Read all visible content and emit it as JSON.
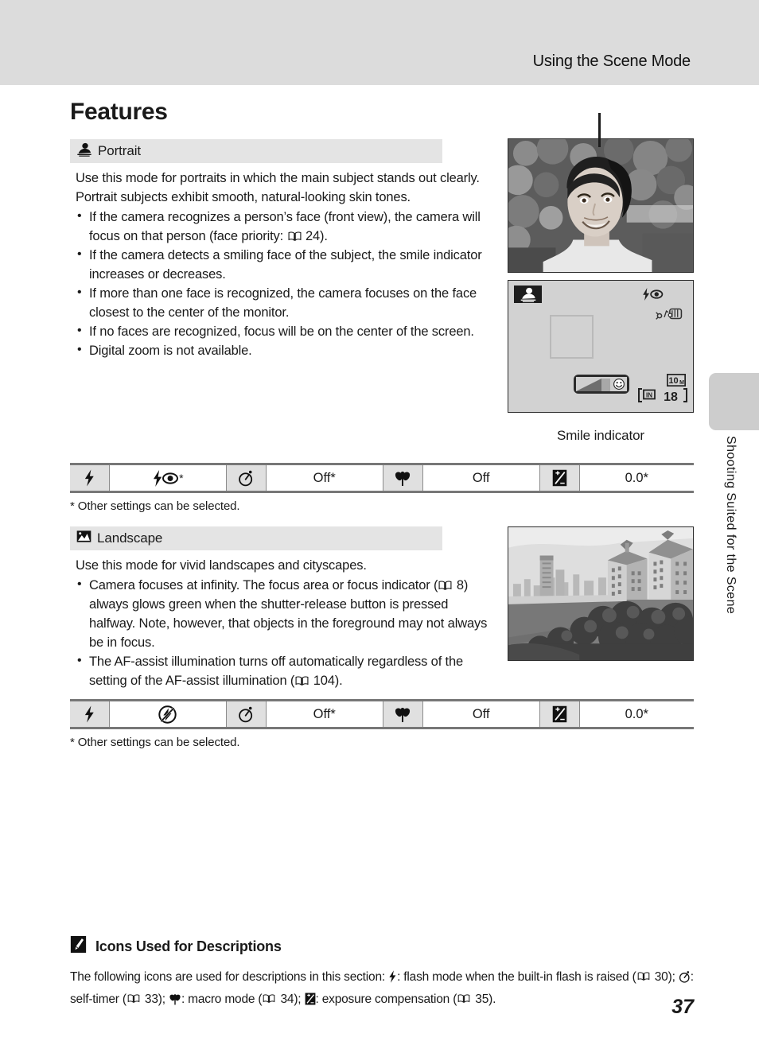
{
  "header": {
    "running_title": "Using the Scene Mode"
  },
  "page_heading": "Features",
  "sections": [
    {
      "id": "portrait",
      "icon": "portrait-mode-icon",
      "title": "Portrait",
      "intro": "Use this mode for portraits in which the main subject stands out clearly. Portrait subjects exhibit smooth, natural-looking skin tones.",
      "bullets": [
        {
          "pre": "If the camera recognizes a person’s face (front view), the camera will focus on that person (face priority: ",
          "ref": "24",
          "post": ")."
        },
        {
          "pre": "If the camera detects a smiling face of the subject, the smile indicator increases or decreases.",
          "ref": "",
          "post": ""
        },
        {
          "pre": "If more than one face is recognized, the camera focuses on the face closest to the center of the monitor.",
          "ref": "",
          "post": ""
        },
        {
          "pre": "If no faces are recognized, focus will be on the center of the screen.",
          "ref": "",
          "post": ""
        },
        {
          "pre": "Digital zoom is not available.",
          "ref": "",
          "post": ""
        }
      ]
    },
    {
      "id": "landscape",
      "icon": "landscape-mode-icon",
      "title": "Landscape",
      "intro": "Use this mode for vivid landscapes and cityscapes.",
      "bullets": [
        {
          "pre": "Camera focuses at infinity. The focus area or focus indicator (",
          "ref": "8",
          "post": ") always glows green when the shutter-release button is pressed halfway. Note, however, that objects in the foreground may not always be in focus."
        },
        {
          "pre": "The AF-assist illumination turns off automatically regardless of the setting of the AF-assist illumination (",
          "ref": "104",
          "post": ")."
        }
      ]
    }
  ],
  "monitor": {
    "mode_icon": "portrait-mode-icon",
    "flash_icon": "flash-red-eye-icon",
    "vr_icon": "vibration-reduction-icon",
    "focus_frame": "focus-area-frame",
    "smile_indicator_icon": "smiley-face-icon",
    "image_size": "10",
    "image_size_unit": "M",
    "memory_label": "IN",
    "shots_remaining": "18",
    "caption": "Smile indicator"
  },
  "photos": [
    {
      "name": "portrait-sample-photo",
      "alt": "Black and white photo of a smiling woman outdoors in front of foliage"
    },
    {
      "name": "landscape-sample-photo",
      "alt": "Black and white photo of apartment buildings beside water with trees"
    }
  ],
  "settings_tables": [
    {
      "id": "portrait-settings",
      "cells": [
        {
          "type": "icon",
          "icon": "flash-mode-icon"
        },
        {
          "type": "value",
          "value": "",
          "icon": "flash-auto-red-eye-icon",
          "suffix": "*"
        },
        {
          "type": "icon",
          "icon": "self-timer-icon"
        },
        {
          "type": "value",
          "value": "Off*"
        },
        {
          "type": "icon",
          "icon": "macro-mode-icon"
        },
        {
          "type": "value",
          "value": "Off"
        },
        {
          "type": "icon",
          "icon": "exposure-compensation-icon"
        },
        {
          "type": "value",
          "value": "0.0*"
        }
      ],
      "footnote": "*  Other settings can be selected."
    },
    {
      "id": "landscape-settings",
      "cells": [
        {
          "type": "icon",
          "icon": "flash-mode-icon"
        },
        {
          "type": "value",
          "value": "",
          "icon": "flash-off-icon",
          "suffix": ""
        },
        {
          "type": "icon",
          "icon": "self-timer-icon"
        },
        {
          "type": "value",
          "value": "Off*"
        },
        {
          "type": "icon",
          "icon": "macro-mode-icon"
        },
        {
          "type": "value",
          "value": "Off"
        },
        {
          "type": "icon",
          "icon": "exposure-compensation-icon"
        },
        {
          "type": "value",
          "value": "0.0*"
        }
      ],
      "footnote": "*  Other settings can be selected."
    }
  ],
  "side_tab": {
    "label": "Shooting Suited for the Scene"
  },
  "note": {
    "icon": "pencil-note-icon",
    "title": "Icons Used for Descriptions",
    "lead": "The following icons are used for descriptions in this section: ",
    "items": [
      {
        "icon": "flash-mode-icon",
        "text": ": flash mode when the built-in flash is raised (",
        "ref": "30",
        "post": "); "
      },
      {
        "icon": "self-timer-icon",
        "text": ": self-timer (",
        "ref": "33",
        "post": "); "
      },
      {
        "icon": "macro-mode-icon",
        "text": ": macro mode (",
        "ref": "34",
        "post": "); "
      },
      {
        "icon": "exposure-compensation-icon",
        "text": ": exposure compensation (",
        "ref": "35",
        "post": ")."
      }
    ]
  },
  "page_number": "37",
  "colors": {
    "header_band": "#dcdcdc",
    "section_bar": "#e4e4e4",
    "table_icon_cell": "#e0e0e0",
    "monitor_bg": "#d2d2d2",
    "side_tab": "#cdcdcd"
  }
}
